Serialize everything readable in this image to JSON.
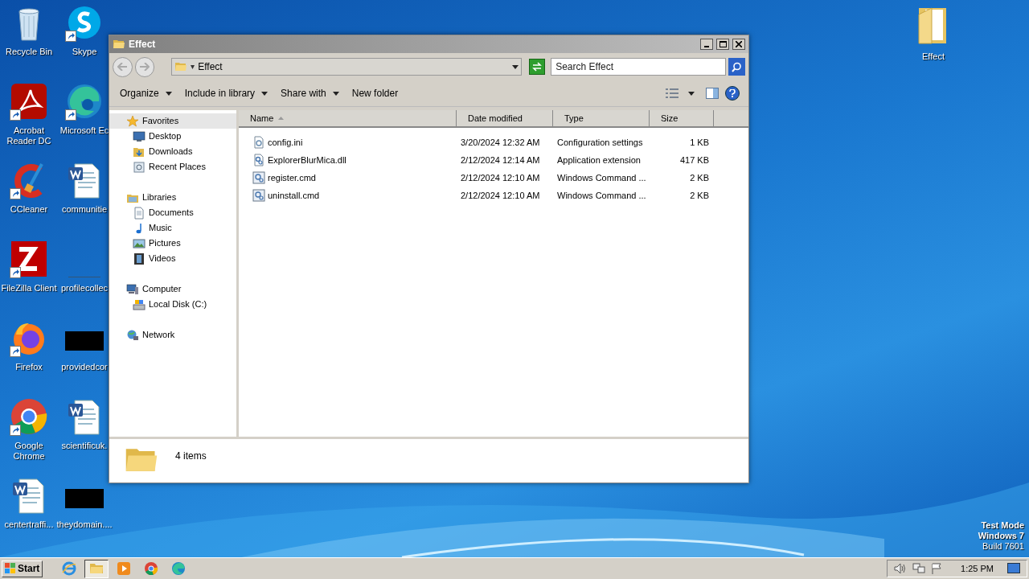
{
  "desktop_icons": [
    {
      "label": "Recycle Bin",
      "shortcut": false
    },
    {
      "label": "Skype",
      "shortcut": true
    },
    {
      "label": "Acrobat Reader DC",
      "shortcut": true
    },
    {
      "label": "Microsoft Ec",
      "shortcut": true
    },
    {
      "label": "CCleaner",
      "shortcut": true
    },
    {
      "label": "communitie",
      "shortcut": false
    },
    {
      "label": "FileZilla Client",
      "shortcut": true
    },
    {
      "label": "profilecollec",
      "shortcut": false
    },
    {
      "label": "Firefox",
      "shortcut": true
    },
    {
      "label": "providedcor",
      "shortcut": false
    },
    {
      "label": "Google Chrome",
      "shortcut": true
    },
    {
      "label": "scientificuk.",
      "shortcut": false
    },
    {
      "label": "centertraffi...",
      "shortcut": false
    },
    {
      "label": "theydomain....",
      "shortcut": false
    }
  ],
  "desktop_folder": {
    "label": "Effect"
  },
  "window": {
    "title": "Effect",
    "address": {
      "path": "Effect"
    },
    "search": {
      "placeholder": "Search Effect"
    },
    "toolbar": [
      {
        "label": "Organize",
        "dropdown": true
      },
      {
        "label": "Include in library",
        "dropdown": true
      },
      {
        "label": "Share with",
        "dropdown": true
      },
      {
        "label": "New folder",
        "dropdown": false
      }
    ],
    "nav": [
      {
        "label": "Favorites",
        "selected": true,
        "children": [
          {
            "label": "Desktop",
            "selected": false
          },
          {
            "label": "Downloads",
            "selected": false
          },
          {
            "label": "Recent Places",
            "selected": false
          }
        ]
      },
      {
        "label": "Libraries",
        "selected": false,
        "children": [
          {
            "label": "Documents",
            "selected": false
          },
          {
            "label": "Music",
            "selected": false
          },
          {
            "label": "Pictures",
            "selected": false
          },
          {
            "label": "Videos",
            "selected": false
          }
        ]
      },
      {
        "label": "Computer",
        "selected": false,
        "children": [
          {
            "label": "Local Disk (C:)",
            "selected": false
          }
        ]
      },
      {
        "label": "Network",
        "selected": false
      }
    ],
    "columns": [
      {
        "label": "Name",
        "sorted": true
      },
      {
        "label": "Date modified",
        "sorted": false
      },
      {
        "label": "Type",
        "sorted": false
      },
      {
        "label": "Size",
        "sorted": false
      }
    ],
    "files": [
      {
        "name": "config.ini",
        "date": "3/20/2024 12:32 AM",
        "type": "Configuration settings",
        "size": "1 KB"
      },
      {
        "name": "ExplorerBlurMica.dll",
        "date": "2/12/2024 12:14 AM",
        "type": "Application extension",
        "size": "417 KB"
      },
      {
        "name": "register.cmd",
        "date": "2/12/2024 12:10 AM",
        "type": "Windows Command ...",
        "size": "2 KB"
      },
      {
        "name": "uninstall.cmd",
        "date": "2/12/2024 12:10 AM",
        "type": "Windows Command ...",
        "size": "2 KB"
      }
    ],
    "status": {
      "count": "4 items"
    }
  },
  "taskbar": {
    "start": "Start",
    "pinned": [
      {
        "active": false
      },
      {
        "active": true
      },
      {
        "active": false
      },
      {
        "active": false
      },
      {
        "active": false
      }
    ],
    "clock": "1:25 PM"
  },
  "test_mode": [
    "Test Mode",
    "Windows 7",
    "Build 7601"
  ]
}
